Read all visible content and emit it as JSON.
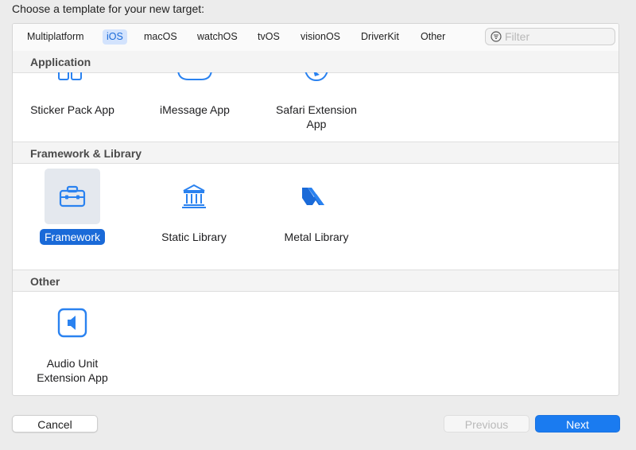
{
  "heading": "Choose a template for your new target:",
  "tabs": [
    {
      "label": "Multiplatform"
    },
    {
      "label": "iOS",
      "active": true
    },
    {
      "label": "macOS"
    },
    {
      "label": "watchOS"
    },
    {
      "label": "tvOS"
    },
    {
      "label": "visionOS"
    },
    {
      "label": "DriverKit"
    },
    {
      "label": "Other"
    }
  ],
  "filter": {
    "placeholder": "Filter",
    "value": ""
  },
  "sections": {
    "application": {
      "title": "Application",
      "items": [
        {
          "label": "Sticker Pack App",
          "icon": "sticker-pack-icon"
        },
        {
          "label": "iMessage App",
          "icon": "imessage-app-icon"
        },
        {
          "label": "Safari Extension App",
          "icon": "safari-extension-icon"
        }
      ]
    },
    "framework": {
      "title": "Framework & Library",
      "items": [
        {
          "label": "Framework",
          "icon": "toolbox-icon",
          "selected": true
        },
        {
          "label": "Static Library",
          "icon": "library-building-icon"
        },
        {
          "label": "Metal Library",
          "icon": "metal-icon"
        }
      ]
    },
    "other": {
      "title": "Other",
      "items": [
        {
          "label": "Audio Unit Extension App",
          "icon": "speaker-icon"
        }
      ]
    }
  },
  "buttons": {
    "cancel": "Cancel",
    "previous": "Previous",
    "next": "Next"
  },
  "colors": {
    "accent": "#1a6ad8",
    "next_button": "#1a7bf0",
    "icon_blue": "#2a82f0"
  }
}
